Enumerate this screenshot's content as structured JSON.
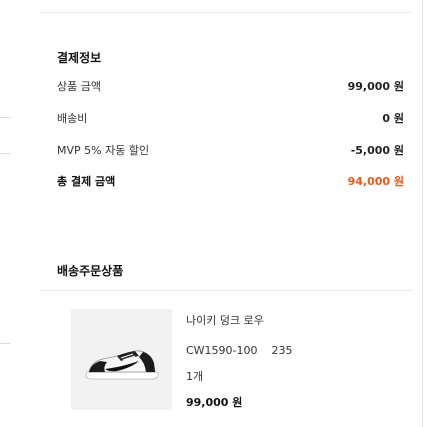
{
  "payment_info": {
    "title": "결제정보",
    "rows": [
      {
        "label": "상품 금액",
        "value": "99,000 원"
      },
      {
        "label": "배송비",
        "value": "0 원"
      },
      {
        "label": "MVP 5% 자동 할인",
        "value": "-5,000 원"
      }
    ],
    "total": {
      "label": "총 결제 금액",
      "value": "94,000 원"
    },
    "colors": {
      "total_accent": "#e8591a"
    }
  },
  "shipping_order_products": {
    "title": "배송주문상품",
    "items": [
      {
        "thumbnail_icon": "sneaker-thumbnail-icon",
        "name": "나이키 덩크 로우",
        "model_code": "CW1590-100",
        "size": "235",
        "quantity": "1개",
        "price": "99,000 원"
      }
    ]
  }
}
